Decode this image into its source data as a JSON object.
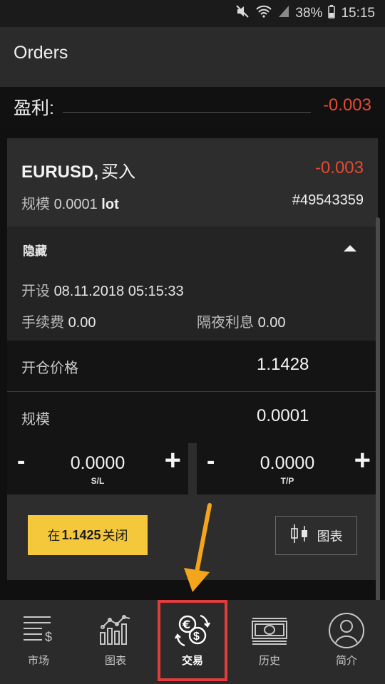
{
  "status_bar": {
    "battery": "38%",
    "time": "15:15"
  },
  "app_bar": {
    "title": "Orders"
  },
  "profit": {
    "label": "盈利:",
    "value": "-0.003"
  },
  "order": {
    "symbol": "EURUSD,",
    "side": "买入",
    "pnl": "-0.003",
    "size_label": "规模",
    "size_value": "0.0001",
    "size_unit": "lot",
    "ticket": "#49543359",
    "hide_label": "隐藏",
    "open_label": "开设",
    "open_time": "08.11.2018 05:15:33",
    "commission_label": "手续费",
    "commission_value": "0.00",
    "swap_label": "隔夜利息",
    "swap_value": "0.00",
    "open_price_label": "开仓价格",
    "open_price_value": "1.1428",
    "volume_label": "规模",
    "volume_value": "0.0001",
    "sl": {
      "minus": "-",
      "value": "0.0000",
      "plus": "+",
      "tag": "S/L"
    },
    "tp": {
      "minus": "-",
      "value": "0.0000",
      "plus": "+",
      "tag": "T/P"
    },
    "close_prefix": "在",
    "close_price": "1.1425",
    "close_suffix": "关闭",
    "chart_label": "图表"
  },
  "bottom_nav": [
    {
      "label": "市场",
      "icon": "market-icon",
      "active": false
    },
    {
      "label": "图表",
      "icon": "chart-icon",
      "active": false
    },
    {
      "label": "交易",
      "icon": "trade-exchange-icon",
      "active": true
    },
    {
      "label": "历史",
      "icon": "history-banknote-icon",
      "active": false
    },
    {
      "label": "简介",
      "icon": "profile-icon",
      "active": false
    }
  ],
  "colors": {
    "accent_yellow": "#f5c83c",
    "loss_red": "#e34b33",
    "highlight_red": "#e23c3c",
    "arrow_orange": "#f4a51c"
  }
}
